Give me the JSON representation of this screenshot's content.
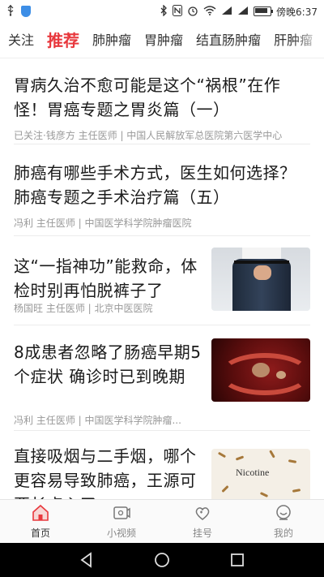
{
  "status_bar": {
    "time": "傍晚6:37",
    "signal_label_1": "4G",
    "signal_label_2": "3G"
  },
  "tabs": [
    {
      "label": "关注"
    },
    {
      "label": "推荐",
      "active": true
    },
    {
      "label": "肺肿瘤"
    },
    {
      "label": "胃肿瘤"
    },
    {
      "label": "结直肠肿瘤"
    },
    {
      "label": "肝肿瘤"
    }
  ],
  "articles": [
    {
      "title": "胃病久治不愈可能是这个“祸根”在作怪！胃癌专题之胃炎篇（一）",
      "meta": "已关注·钱彦方 主任医师 | 中国人民解放军总医院第六医学中心"
    },
    {
      "title": "肺癌有哪些手术方式，医生如何选择？肺癌专题之手术治疗篇（五）",
      "meta": "冯利 主任医师 | 中国医学科学院肿瘤医院"
    },
    {
      "title": "这“一指神功”能救命，体检时别再怕脱裤子了",
      "meta": "杨国旺 主任医师 | 北京中医医院"
    },
    {
      "title": "8成患者忽略了肠癌早期5个症状 确诊时已到晚期",
      "meta": "冯利 主任医师 | 中国医学科学院肿瘤..."
    },
    {
      "title": "直接吸烟与二手烟，哪个更容易导致肺癌，王源可要长点心了",
      "meta": "",
      "thumb_text": "Nicotine"
    }
  ],
  "bottom_nav": [
    {
      "label": "首页",
      "icon": "home-icon",
      "active": true
    },
    {
      "label": "小视频",
      "icon": "video-icon"
    },
    {
      "label": "挂号",
      "icon": "heart-hands-icon"
    },
    {
      "label": "我的",
      "icon": "profile-icon"
    }
  ],
  "colors": {
    "accent": "#e8383d",
    "text": "#1a1a1a",
    "meta": "#999999"
  }
}
